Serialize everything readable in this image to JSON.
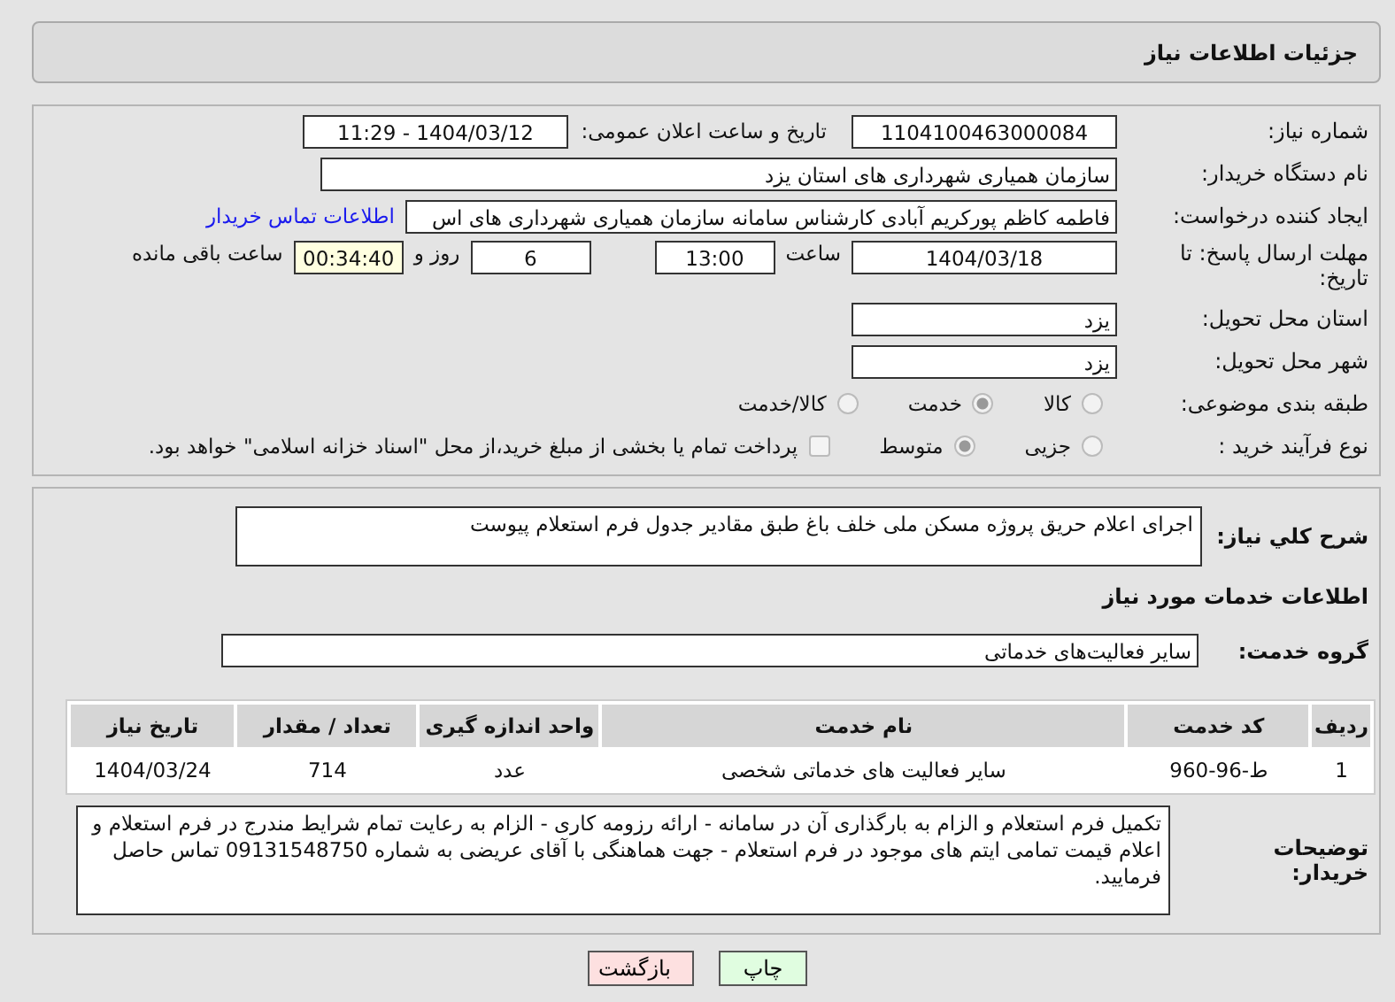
{
  "header": {
    "title": "جزئیات اطلاعات نیاز"
  },
  "details": {
    "need_number": {
      "label": "شماره نیاز:",
      "value": "1104100463000084"
    },
    "announce": {
      "label": "تاریخ و ساعت اعلان عمومی:",
      "value": "1404/03/12 - 11:29"
    },
    "buyer_org": {
      "label": "نام دستگاه خریدار:",
      "value": "سازمان همیاری شهرداری های استان یزد"
    },
    "requester": {
      "label": "ایجاد کننده درخواست:",
      "value": "فاطمه کاظم پورکریم آبادی کارشناس سامانه سازمان همیاری شهرداری های اس",
      "link": "اطلاعات تماس خریدار"
    },
    "deadline": {
      "label": "مهلت ارسال پاسخ: تا تاریخ:",
      "date": "1404/03/18",
      "time_label": "ساعت",
      "time": "13:00",
      "days": "6",
      "days_label": "روز و",
      "remaining": "00:34:40",
      "remaining_label": "ساعت باقی مانده"
    },
    "province": {
      "label": "استان محل تحویل:",
      "value": "یزد"
    },
    "city": {
      "label": "شهر محل تحویل:",
      "value": "یزد"
    },
    "category": {
      "label": "طبقه بندی موضوعی:",
      "options": [
        {
          "label": "كالا",
          "selected": false
        },
        {
          "label": "خدمت",
          "selected": true
        },
        {
          "label": "کالا/خدمت",
          "selected": false
        }
      ]
    },
    "purchase_type": {
      "label": "نوع فرآیند خرید :",
      "options": [
        {
          "label": "جزیی",
          "selected": false
        },
        {
          "label": "متوسط",
          "selected": true
        }
      ],
      "payment_checkbox": {
        "checked": false,
        "label": "پرداخت تمام یا بخشی از مبلغ خرید،از محل \"اسناد خزانه اسلامی\" خواهد بود."
      }
    }
  },
  "description": {
    "label": "شرح کلي نياز:",
    "value": "اجرای اعلام حریق پروژه مسکن ملی خلف باغ طبق مقادیر جدول فرم استعلام پیوست"
  },
  "services_title": "اطلاعات خدمات مورد نياز",
  "service_group": {
    "label": "گروه خدمت:",
    "value": "سایر فعالیت‌های خدماتی"
  },
  "table": {
    "columns": [
      "ردیف",
      "کد خدمت",
      "نام خدمت",
      "واحد اندازه گیری",
      "تعداد / مقدار",
      "تاریخ نیاز"
    ],
    "rows": [
      [
        "1",
        "ط-96-960",
        "سایر فعالیت های خدماتی شخصی",
        "عدد",
        "714",
        "1404/03/24"
      ]
    ]
  },
  "buyer_notes": {
    "label": "توضیحات خریدار:",
    "value": "تکمیل فرم استعلام و الزام به بارگذاری آن در سامانه - ارائه رزومه کاری - الزام به رعایت تمام شرایط مندرج در فرم استعلام و اعلام قیمت تمامی ایتم های موجود در فرم استعلام - جهت هماهنگی با آقای عریضی به شماره 09131548750 تماس حاصل فرمایید."
  },
  "buttons": [
    {
      "label": "چاپ",
      "kind": "print"
    },
    {
      "label": "بازگشت",
      "kind": "back"
    }
  ]
}
